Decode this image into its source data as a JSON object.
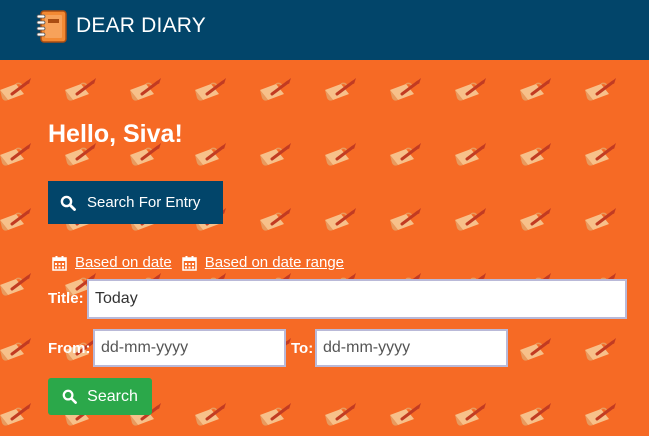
{
  "app": {
    "title": "DEAR DIARY",
    "brand_color": "#02456a",
    "background_color": "#f66a25"
  },
  "main": {
    "greeting": "Hello, Siva!",
    "search_entry_button": "Search For Entry",
    "filters": [
      {
        "label": "Based on date",
        "icon": "calendar-icon"
      },
      {
        "label": "Based on date range",
        "icon": "calendar-icon"
      }
    ],
    "title_label": "Title:",
    "title_value": "Today",
    "from_label": "From:",
    "from_placeholder": "dd-mm-yyyy",
    "to_label": "To:",
    "to_placeholder": "dd-mm-yyyy",
    "search_button": "Search",
    "search_button_color": "#2ba84a"
  },
  "icons": {
    "brand": "notebook-icon",
    "search": "search-icon",
    "pattern": "scroll-quill-icon"
  }
}
